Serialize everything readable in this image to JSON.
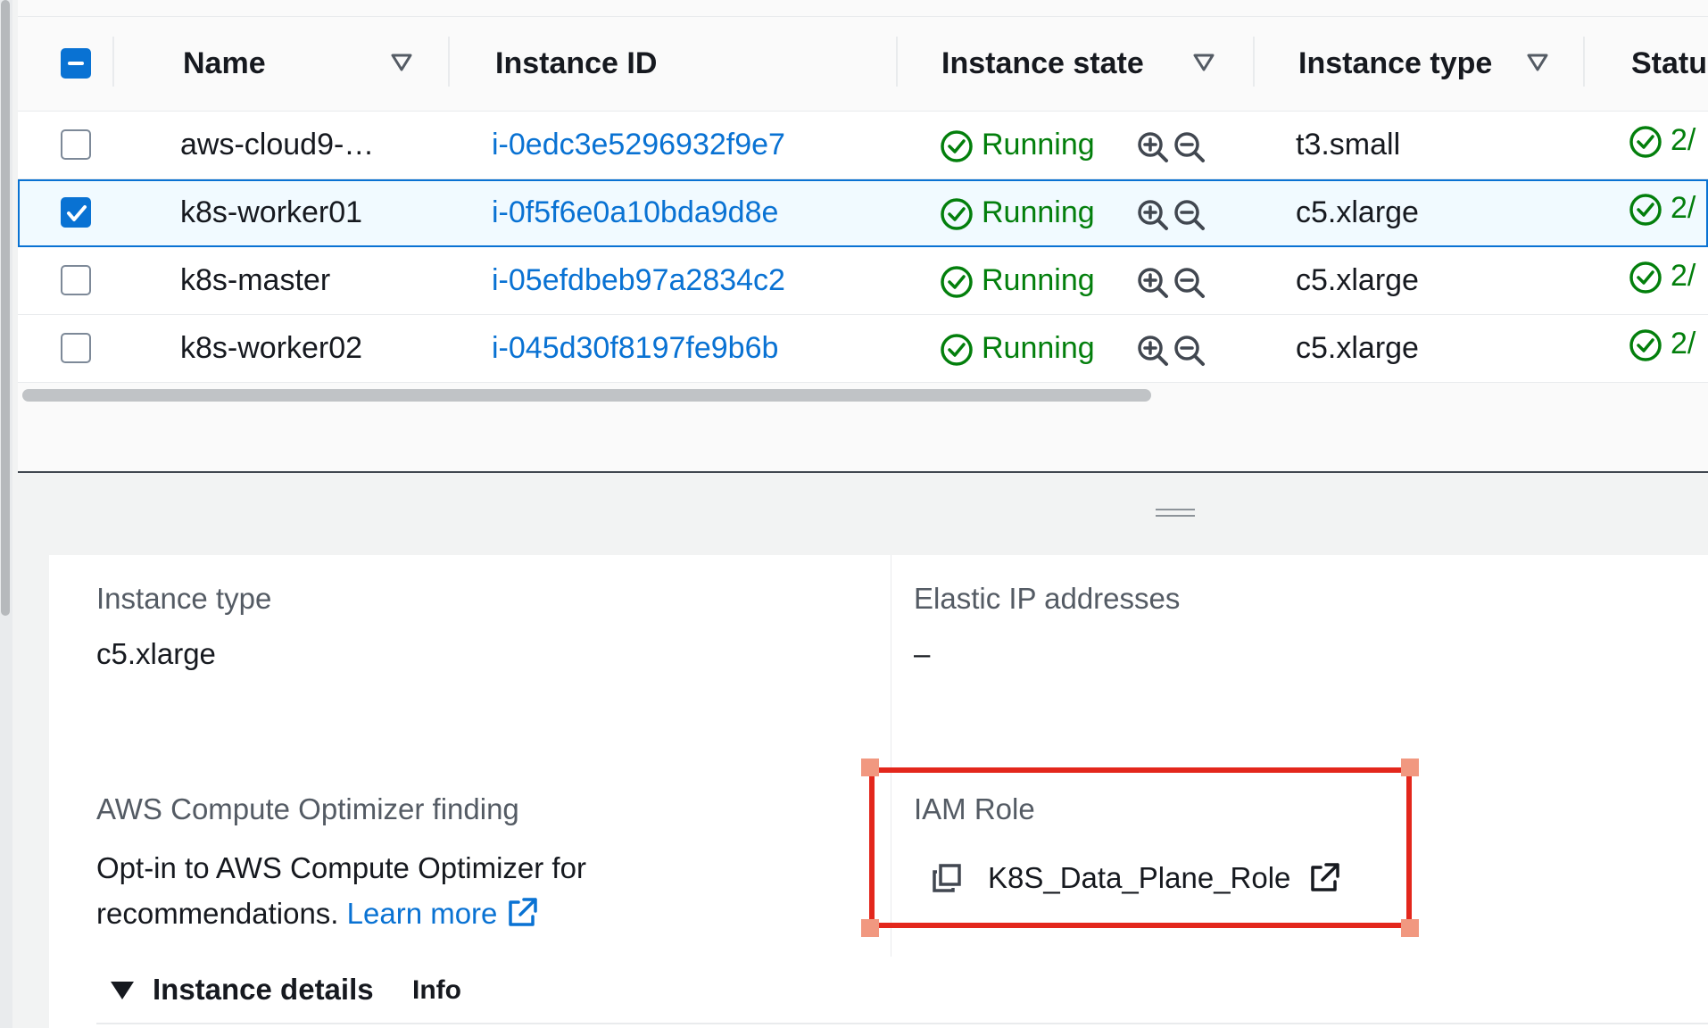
{
  "table": {
    "columns": [
      "Name",
      "Instance ID",
      "Instance state",
      "Instance type",
      "Statu"
    ],
    "rows": [
      {
        "name": "aws-cloud9-…",
        "instance_id": "i-0edc3e5296932f9e7",
        "state": "Running",
        "type": "t3.small",
        "status": "2/",
        "selected": false
      },
      {
        "name": "k8s-worker01",
        "instance_id": "i-0f5f6e0a10bda9d8e",
        "state": "Running",
        "type": "c5.xlarge",
        "status": "2/",
        "selected": true
      },
      {
        "name": "k8s-master",
        "instance_id": "i-05efdbeb97a2834c2",
        "state": "Running",
        "type": "c5.xlarge",
        "status": "2/",
        "selected": false
      },
      {
        "name": "k8s-worker02",
        "instance_id": "i-045d30f8197fe9b6b",
        "state": "Running",
        "type": "c5.xlarge",
        "status": "2/",
        "selected": false
      }
    ]
  },
  "details": {
    "instance_type_label": "Instance type",
    "instance_type_value": "c5.xlarge",
    "elastic_ip_label": "Elastic IP addresses",
    "elastic_ip_value": "–",
    "optimizer_label": "AWS Compute Optimizer finding",
    "optimizer_text_line1": "Opt-in to AWS Compute Optimizer for",
    "optimizer_text_line2": "recommendations.",
    "learn_more": "Learn more",
    "iam_role_label": "IAM Role",
    "iam_role_value": "K8S_Data_Plane_Role",
    "section_title": "Instance details",
    "info_link": "Info"
  },
  "colors": {
    "link": "#0972d3",
    "running": "#037f0c",
    "highlight_box": "#e3271c",
    "selected_bg": "#f1faff"
  },
  "icons": [
    "checkbox-indeterminate",
    "sort-triangle-icon",
    "check-circle-icon",
    "zoom-in-icon",
    "zoom-out-icon",
    "copy-icon",
    "external-link-icon",
    "caret-down-icon"
  ]
}
